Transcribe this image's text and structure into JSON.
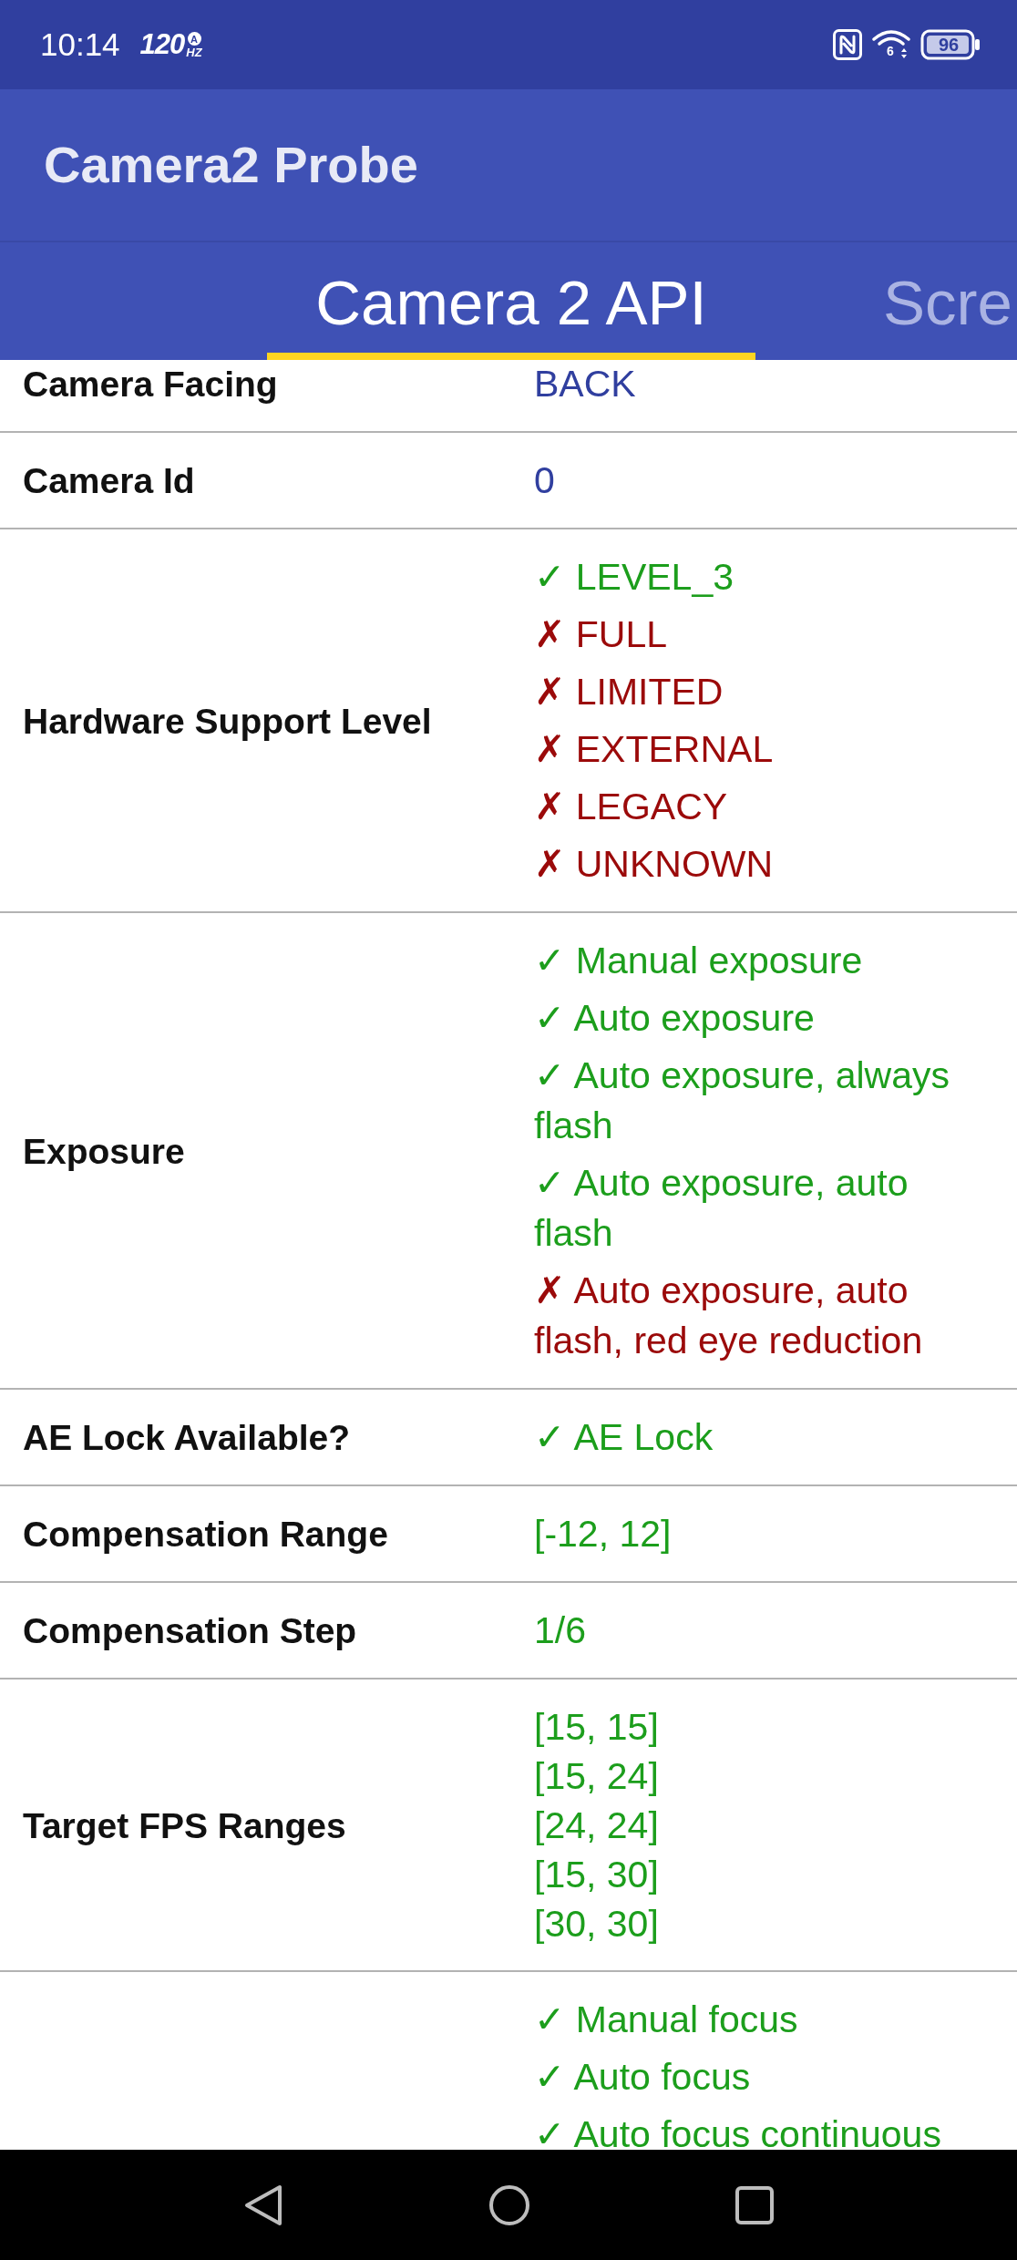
{
  "status_bar": {
    "time": "10:14",
    "refresh_rate": "120",
    "refresh_badge": "A",
    "refresh_unit": "HZ",
    "wifi_badge": "6",
    "battery": "96"
  },
  "app_bar": {
    "title": "Camera2 Probe"
  },
  "tabs": [
    {
      "label": "Camera 2 API",
      "selected": true
    },
    {
      "label": "Scre",
      "selected": false
    }
  ],
  "table": {
    "rows": [
      {
        "label": "Camera Facing",
        "kind": "text",
        "values": [
          "BACK"
        ]
      },
      {
        "label": "Camera Id",
        "kind": "text",
        "values": [
          "0"
        ]
      },
      {
        "label": "Hardware Support Level",
        "kind": "features",
        "items": [
          {
            "text": "✓ LEVEL_3",
            "supported": true
          },
          {
            "text": "✗ FULL",
            "supported": false
          },
          {
            "text": "✗ LIMITED",
            "supported": false
          },
          {
            "text": "✗ EXTERNAL",
            "supported": false
          },
          {
            "text": "✗ LEGACY",
            "supported": false
          },
          {
            "text": "✗ UNKNOWN",
            "supported": false
          }
        ]
      },
      {
        "label": "Exposure",
        "kind": "features",
        "items": [
          {
            "text": "✓ Manual exposure",
            "supported": true
          },
          {
            "text": "✓ Auto exposure",
            "supported": true
          },
          {
            "text": "✓ Auto exposure, always flash",
            "supported": true
          },
          {
            "text": "✓ Auto exposure, auto flash",
            "supported": true
          },
          {
            "text": "✗ Auto exposure, auto flash, red eye reduction",
            "supported": false
          }
        ]
      },
      {
        "label": "AE Lock Available?",
        "kind": "features",
        "items": [
          {
            "text": "✓ AE Lock",
            "supported": true
          }
        ]
      },
      {
        "label": "Compensation Range",
        "kind": "numbers",
        "values": [
          "[-12, 12]"
        ]
      },
      {
        "label": "Compensation Step",
        "kind": "numbers",
        "values": [
          "1/6"
        ]
      },
      {
        "label": "Target FPS Ranges",
        "kind": "numbers",
        "values": [
          "[15, 15]",
          "[15, 24]",
          "[24, 24]",
          "[15, 30]",
          "[30, 30]"
        ]
      },
      {
        "kind": "features",
        "items": [
          {
            "text": "✓ Manual focus",
            "supported": true
          },
          {
            "text": "✓ Auto focus",
            "supported": true
          },
          {
            "text": "✓ Auto focus continuous",
            "supported": true
          }
        ]
      }
    ]
  }
}
